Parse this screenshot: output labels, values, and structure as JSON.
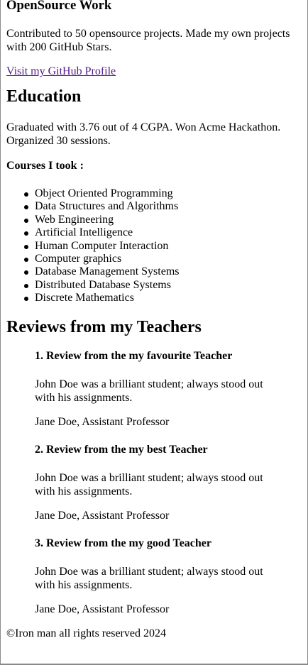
{
  "opensource": {
    "heading": "OpenSource Work",
    "description": "Contributed to 50 opensource projects. Made my own projects with 200 GitHub Stars.",
    "link_label": "Visit my GitHub Profile"
  },
  "education": {
    "heading": "Education",
    "description": "Graduated with 3.76 out of 4 CGPA. Won Acme Hackathon. Organized 30 sessions.",
    "courses_label": "Courses I took :",
    "courses": [
      "Object Oriented Programming",
      "Data Structures and Algorithms",
      "Web Engineering",
      "Artificial Intelligence",
      "Human Computer Interaction",
      "Computer graphics",
      "Database Management Systems",
      "Distributed Database Systems",
      "Discrete Mathematics"
    ]
  },
  "reviews": {
    "heading": "Reviews from my Teachers",
    "items": [
      {
        "title": "1. Review from the my favourite Teacher",
        "text": "John Doe was a brilliant student; always stood out with his assignments.",
        "author": "Jane Doe, Assistant Professor"
      },
      {
        "title": "2. Review from the my best Teacher",
        "text": "John Doe was a brilliant student; always stood out with his assignments.",
        "author": "Jane Doe, Assistant Professor"
      },
      {
        "title": "3. Review from the my good Teacher",
        "text": "John Doe was a brilliant student; always stood out with his assignments.",
        "author": "Jane Doe, Assistant Professor"
      }
    ]
  },
  "footer": {
    "text": "©Iron man all rights reserved 2024"
  }
}
